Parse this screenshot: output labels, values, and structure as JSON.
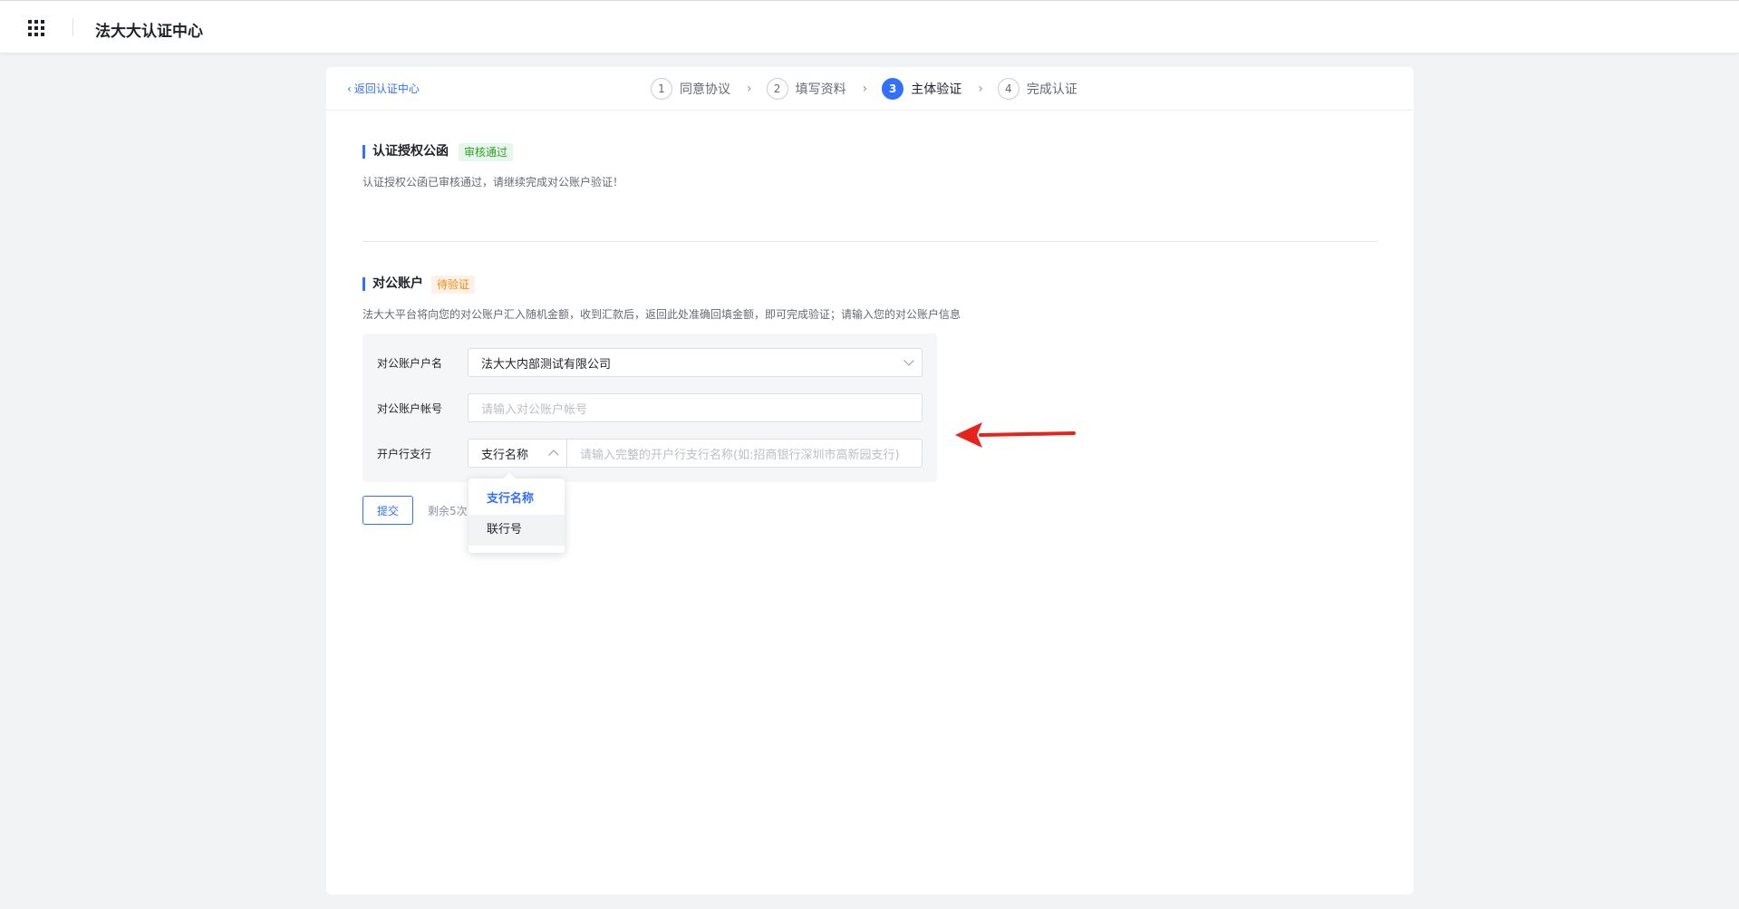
{
  "topbar": {
    "apps_icon": "apps-grid-icon",
    "title": "法大大认证中心"
  },
  "header": {
    "back_label": "返回认证中心",
    "steps": [
      {
        "num": "1",
        "label": "同意协议",
        "active": false
      },
      {
        "num": "2",
        "label": "填写资料",
        "active": false
      },
      {
        "num": "3",
        "label": "主体验证",
        "active": true
      },
      {
        "num": "4",
        "label": "完成认证",
        "active": false
      }
    ]
  },
  "auth_letter": {
    "title": "认证授权公函",
    "status": "审核通过",
    "desc": "认证授权公函已审核通过，请继续完成对公账户验证！"
  },
  "account": {
    "title": "对公账户",
    "status": "待验证",
    "desc": "法大大平台将向您的对公账户汇入随机金额，收到汇款后，返回此处准确回填金额，即可完成验证；请输入您的对公账户信息",
    "name_label": "对公账户户名",
    "name_value": "法大大内部测试有限公司",
    "number_label": "对公账户帐号",
    "number_placeholder": "请输入对公账户帐号",
    "branch_label": "开户行支行",
    "branch_type_value": "支行名称",
    "branch_placeholder": "请输入完整的开户行支行名称(如:招商银行深圳市高新园支行)"
  },
  "dropdown": {
    "options": [
      "支行名称",
      "联行号"
    ],
    "selected": "支行名称"
  },
  "actions": {
    "submit_label": "提交",
    "remaining": "剩余5次"
  },
  "colors": {
    "accent": "#3370ff",
    "annotation_arrow": "#e8231c"
  }
}
